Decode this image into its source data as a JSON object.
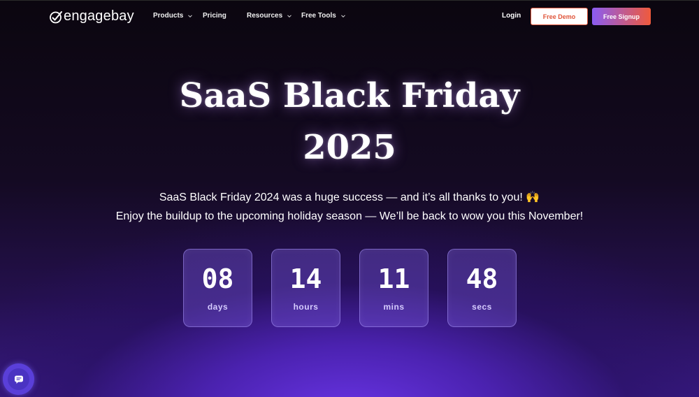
{
  "nav": {
    "brand": "engagebay",
    "items": [
      {
        "label": "Products",
        "has_dropdown": true
      },
      {
        "label": "Pricing",
        "has_dropdown": false
      },
      {
        "label": "Resources",
        "has_dropdown": true
      },
      {
        "label": "Free Tools",
        "has_dropdown": true
      }
    ],
    "login": "Login",
    "demo_button": "Free Demo",
    "signup_button": "Free Signup"
  },
  "hero": {
    "title_line1": "SaaS Black Friday",
    "title_line2": "2025",
    "subtitle_line1": "SaaS Black Friday 2024 was a huge success — and it’s all thanks to you! 🙌",
    "subtitle_line2": "Enjoy the buildup to the upcoming holiday season — We’ll be back to wow you this November!"
  },
  "countdown": [
    {
      "value": "08",
      "label": "days"
    },
    {
      "value": "14",
      "label": "hours"
    },
    {
      "value": "11",
      "label": "mins"
    },
    {
      "value": "48",
      "label": "secs"
    }
  ],
  "colors": {
    "accent_orange": "#e0553a",
    "accent_purple": "#8a5cf2",
    "bg_dark": "#0b060f",
    "bg_purple": "#6a35e8"
  },
  "icons": {
    "logo": "engagebay-check-logo-icon",
    "dropdown": "chevron-down-icon",
    "chat": "chat-bubble-icon"
  }
}
